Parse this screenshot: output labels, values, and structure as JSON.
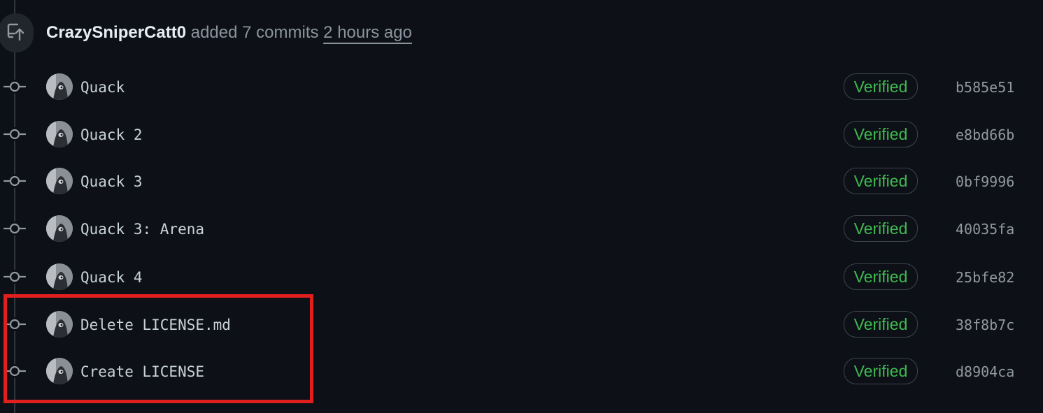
{
  "header": {
    "author": "CrazySniperCatt0",
    "action": "added 7 commits",
    "time": "2 hours ago",
    "icon": "repo-push-icon"
  },
  "commits": [
    {
      "message": "Quack",
      "badge": "Verified",
      "sha": "b585e51"
    },
    {
      "message": "Quack 2",
      "badge": "Verified",
      "sha": "e8bd66b"
    },
    {
      "message": "Quack 3",
      "badge": "Verified",
      "sha": "0bf9996"
    },
    {
      "message": "Quack 3: Arena",
      "badge": "Verified",
      "sha": "40035fa"
    },
    {
      "message": "Quack 4",
      "badge": "Verified",
      "sha": "25bfe82"
    },
    {
      "message": "Delete LICENSE.md",
      "badge": "Verified",
      "sha": "38f8b7c"
    },
    {
      "message": "Create LICENSE",
      "badge": "Verified",
      "sha": "d8904ca"
    }
  ],
  "colors": {
    "background": "#0d1117",
    "verified": "#3fb950",
    "highlight": "#e11f1f"
  }
}
